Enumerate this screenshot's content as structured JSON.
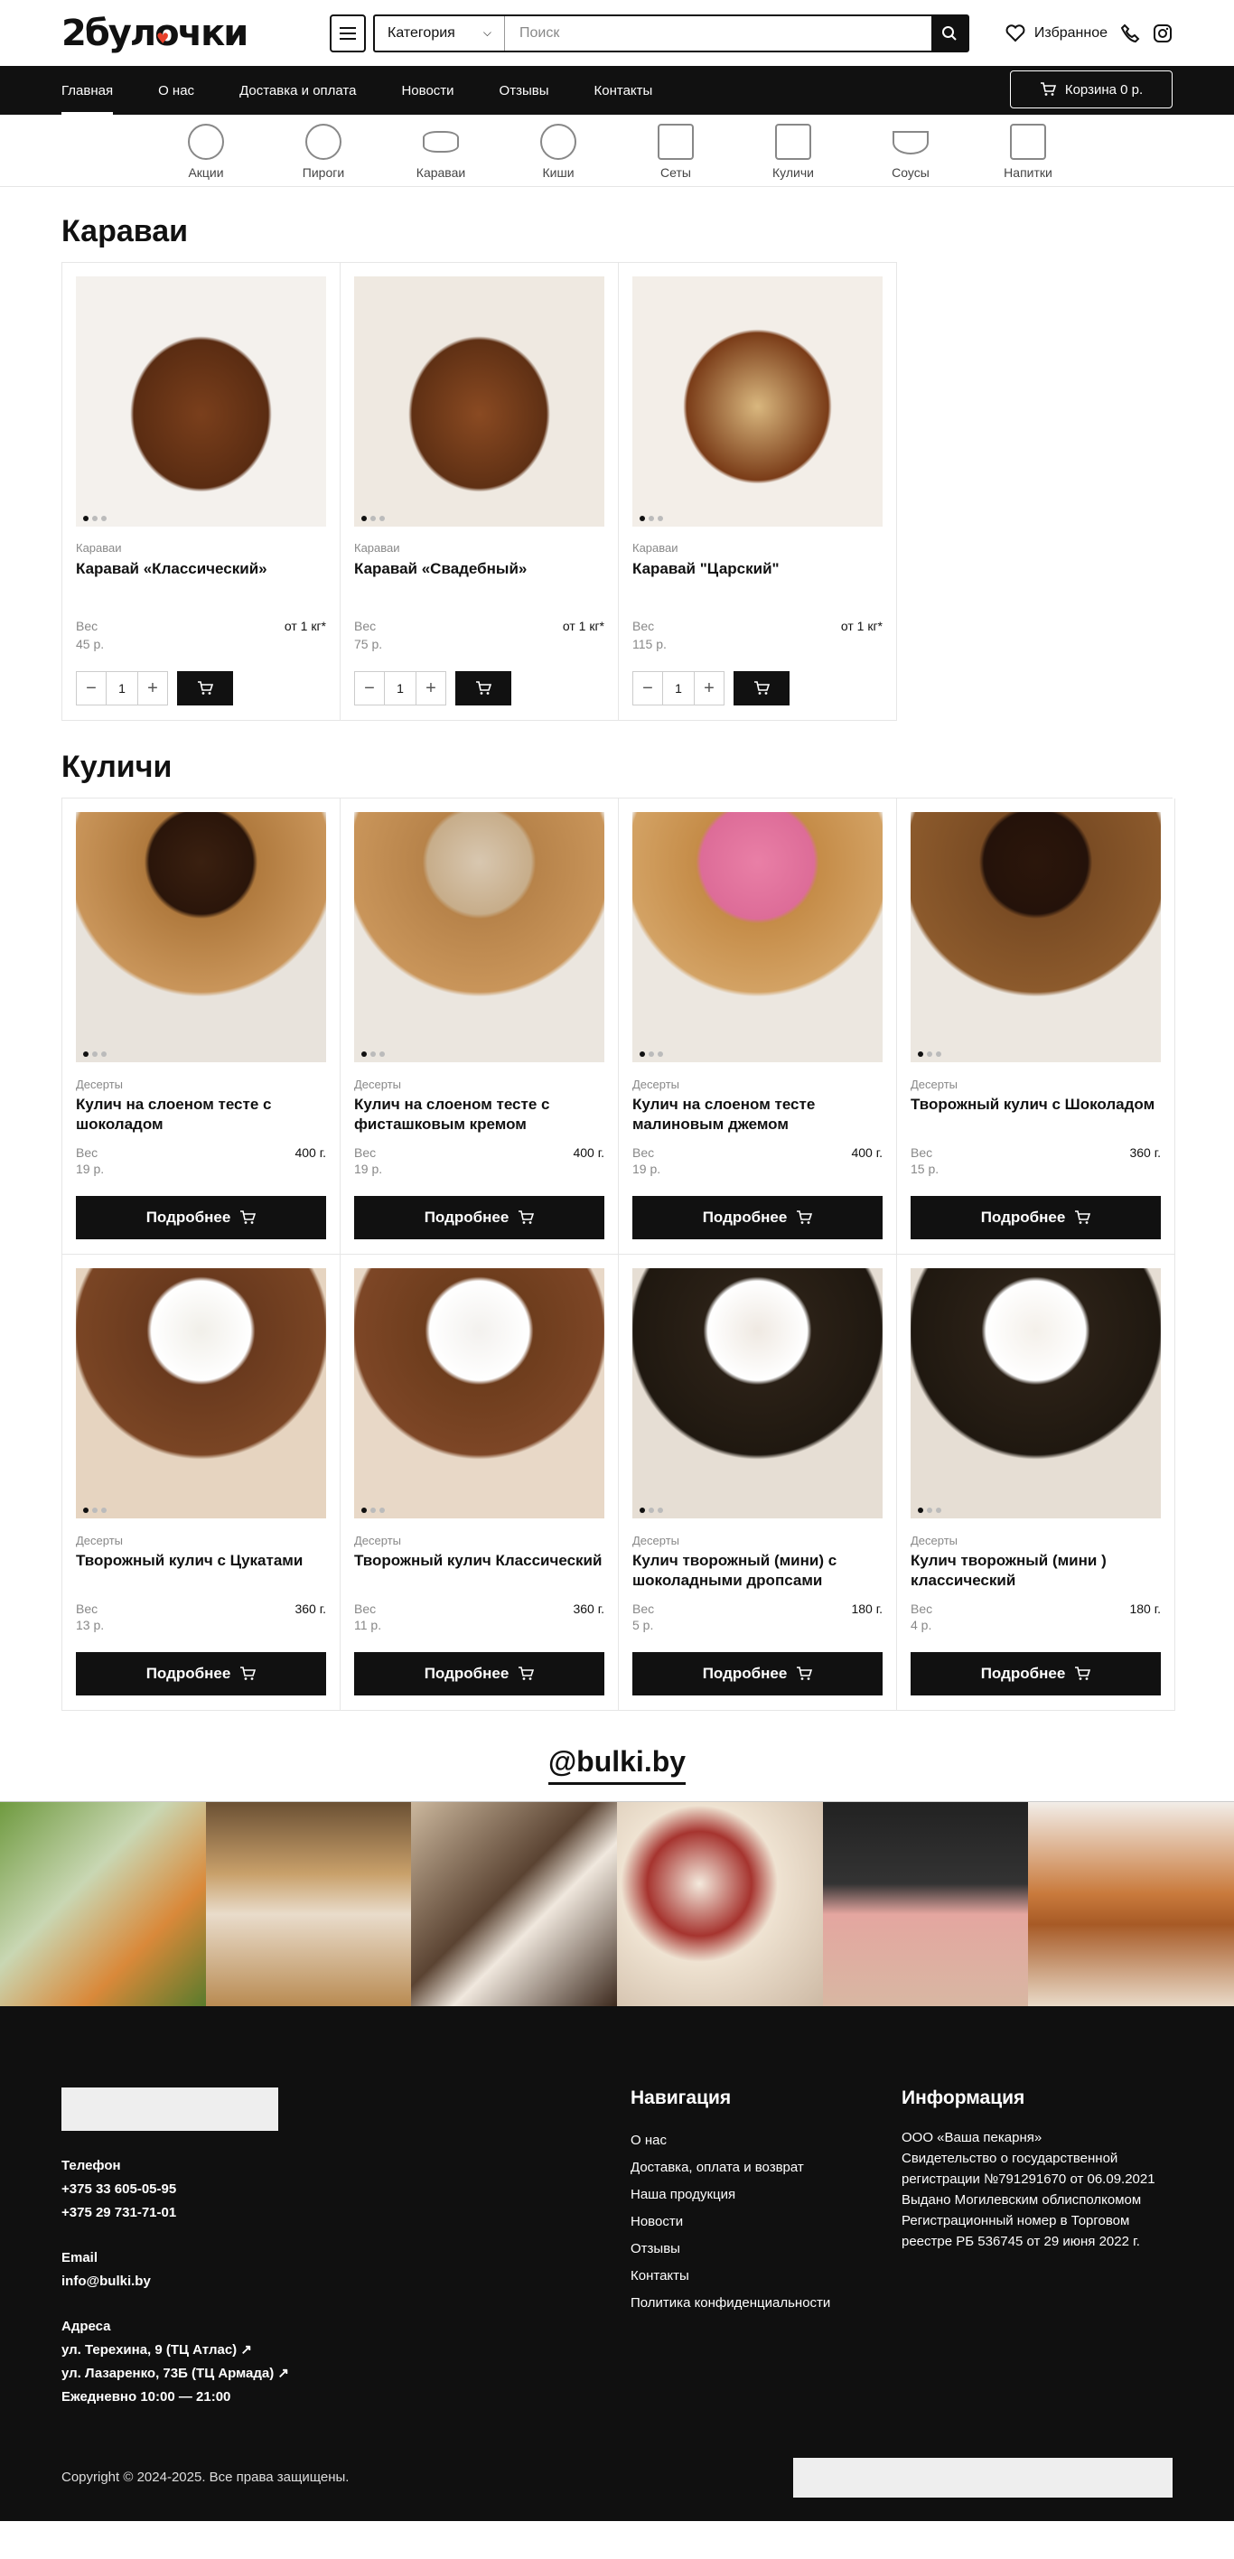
{
  "header": {
    "logo_text": "2булочки",
    "category_label": "Категория",
    "search_placeholder": "Поиск",
    "favorites_label": "Избранное"
  },
  "nav": {
    "items": [
      "Главная",
      "О нас",
      "Доставка и оплата",
      "Новости",
      "Отзывы",
      "Контакты"
    ],
    "cart_label": "Корзина 0 р."
  },
  "categories": [
    "Акции",
    "Пироги",
    "Караваи",
    "Киши",
    "Сеты",
    "Куличи",
    "Соусы",
    "Напитки"
  ],
  "karavai": {
    "title": "Караваи",
    "items": [
      {
        "category": "Караваи",
        "name": "Каравай «Классический»",
        "weight_label": "Вес",
        "weight": "от 1 кг*",
        "price": "45 р.",
        "qty": "1"
      },
      {
        "category": "Караваи",
        "name": "Каравай «Свадебный»",
        "weight_label": "Вес",
        "weight": "от 1 кг*",
        "price": "75 р.",
        "qty": "1"
      },
      {
        "category": "Караваи",
        "name": "Каравай \"Царский\"",
        "weight_label": "Вес",
        "weight": "от 1 кг*",
        "price": "115 р.",
        "qty": "1"
      }
    ]
  },
  "kulichi": {
    "title": "Куличи",
    "button_label": "Подробнее",
    "items": [
      {
        "category": "Десерты",
        "name": "Кулич на слоеном тесте с шоколадом",
        "weight_label": "Вес",
        "weight": "400 г.",
        "price": "19 р."
      },
      {
        "category": "Десерты",
        "name": "Кулич на слоеном тесте с фисташковым кремом",
        "weight_label": "Вес",
        "weight": "400 г.",
        "price": "19 р."
      },
      {
        "category": "Десерты",
        "name": "Кулич на слоеном тесте малиновым джемом",
        "weight_label": "Вес",
        "weight": "400 г.",
        "price": "19 р."
      },
      {
        "category": "Десерты",
        "name": "Творожный кулич с Шоколадом",
        "weight_label": "Вес",
        "weight": "360 г.",
        "price": "15 р."
      },
      {
        "category": "Десерты",
        "name": "Творожный кулич с Цукатами",
        "weight_label": "Вес",
        "weight": "360 г.",
        "price": "13 р."
      },
      {
        "category": "Десерты",
        "name": "Творожный кулич Классический",
        "weight_label": "Вес",
        "weight": "360 г.",
        "price": "11 р."
      },
      {
        "category": "Десерты",
        "name": "Кулич творожный (мини) с шоколадными дропсами",
        "weight_label": "Вес",
        "weight": "180 г.",
        "price": "5 р."
      },
      {
        "category": "Десерты",
        "name": "Кулич творожный (мини ) классический",
        "weight_label": "Вес",
        "weight": "180 г.",
        "price": "4 р."
      }
    ]
  },
  "instagram": {
    "handle": "@bulki.by"
  },
  "footer": {
    "phone_label": "Телефон",
    "phones": [
      "+375 33 605-05-95",
      "+375 29 731-71-01"
    ],
    "email_label": "Email",
    "email": "info@bulki.by",
    "address_label": "Адреса",
    "addresses": [
      "ул. Терехина, 9 (ТЦ Атлас)",
      "ул. Лазаренко, 73Б (ТЦ Армада)"
    ],
    "hours": "Ежедневно 10:00 — 21:00",
    "nav_title": "Навигация",
    "nav_items": [
      "О нас",
      "Доставка, оплата и возврат",
      "Наша продукция",
      "Новости",
      "Отзывы",
      "Контакты",
      "Политика конфиденциальности"
    ],
    "info_title": "Информация",
    "info_lines": [
      "ООО «Ваша пекарня»",
      "Свидетельство о государственной",
      "регистрации №791291670 от 06.09.2021",
      "Выдано Могилевским облисполкомом",
      "Регистрационный номер в Торговом",
      "реестре РБ 536745 от 29 июня 2022 г."
    ],
    "copyright": "Copyright © 2024-2025. Все права защищены."
  }
}
